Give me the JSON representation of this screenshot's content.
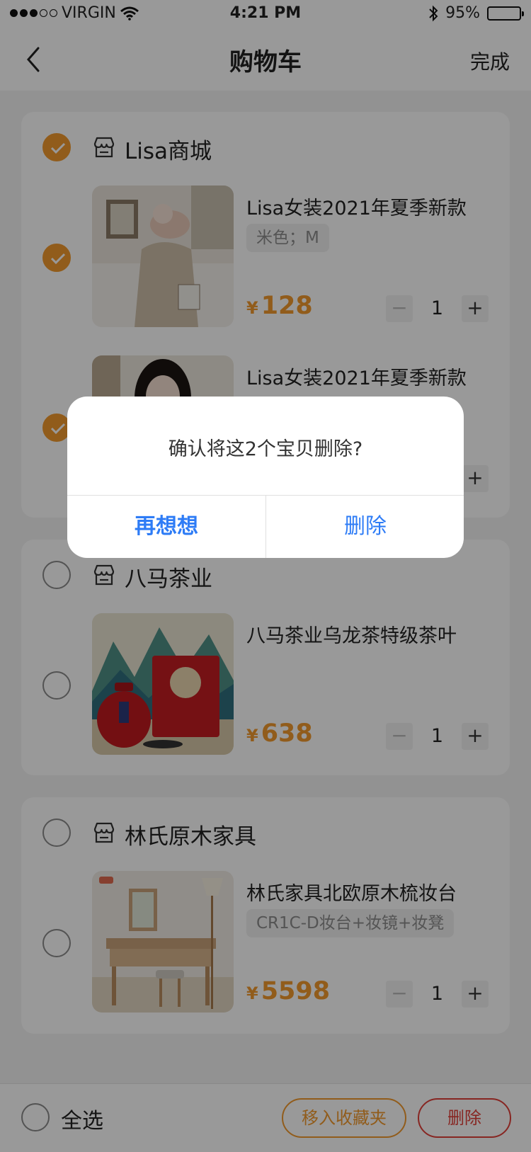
{
  "status_bar": {
    "carrier": "VIRGIN",
    "time": "4:21 PM",
    "battery": "95%"
  },
  "nav": {
    "title": "购物车",
    "action": "完成"
  },
  "shops": [
    {
      "name": "Lisa商城",
      "checked": true,
      "items": [
        {
          "title": "Lisa女装2021年夏季新款",
          "sku": "米色；M",
          "currency": "¥",
          "price": "128",
          "qty": "1",
          "checked": true
        },
        {
          "title": "Lisa女装2021年夏季新款",
          "sku": "",
          "currency": "",
          "price": "",
          "qty": "",
          "checked": true
        }
      ]
    },
    {
      "name": "八马茶业",
      "checked": false,
      "items": [
        {
          "title": "八马茶业乌龙茶特级茶叶",
          "sku": "",
          "currency": "¥",
          "price": "638",
          "qty": "1",
          "checked": false
        }
      ]
    },
    {
      "name": "林氏原木家具",
      "checked": false,
      "items": [
        {
          "title": "林氏家具北欧原木梳妆台",
          "sku": "CR1C-D妆台+妆镜+妆凳",
          "currency": "¥",
          "price": "5598",
          "qty": "1",
          "checked": false
        }
      ]
    }
  ],
  "footer": {
    "select_all": "全选",
    "favorite": "移入收藏夹",
    "delete": "删除"
  },
  "dialog": {
    "message": "确认将这2个宝贝删除?",
    "cancel": "再想想",
    "confirm": "删除"
  },
  "stepper": {
    "minus": "−",
    "plus": "+"
  },
  "colors": {
    "accent": "#f29a2e",
    "danger": "#e2403a",
    "dialog_link": "#2e7cf6"
  }
}
